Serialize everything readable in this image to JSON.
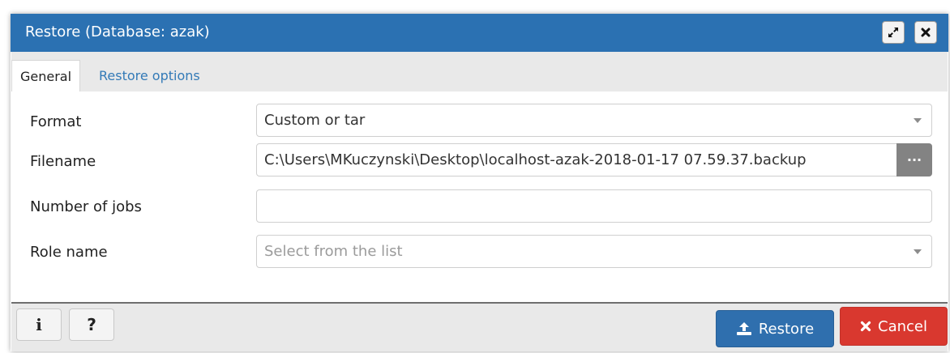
{
  "dialog": {
    "title": "Restore (Database: azak)",
    "maximize_icon": "maximize-icon",
    "close_icon": "close-icon"
  },
  "tabs": [
    {
      "label": "General",
      "active": true
    },
    {
      "label": "Restore options",
      "active": false
    }
  ],
  "form": {
    "format": {
      "label": "Format",
      "value": "Custom or tar"
    },
    "filename": {
      "label": "Filename",
      "value": "C:\\Users\\MKuczynski\\Desktop\\localhost-azak-2018-01-17 07.59.37.backup",
      "browse_label": "···"
    },
    "jobs": {
      "label": "Number of jobs",
      "value": ""
    },
    "role": {
      "label": "Role name",
      "placeholder": "Select from the list"
    }
  },
  "footer": {
    "info_label": "i",
    "help_label": "?",
    "restore_label": "Restore",
    "cancel_label": "Cancel"
  },
  "colors": {
    "titlebar": "#2b71b2",
    "tab_link": "#337ab7",
    "restore_button": "#2f6fae",
    "cancel_button": "#d9382f"
  }
}
